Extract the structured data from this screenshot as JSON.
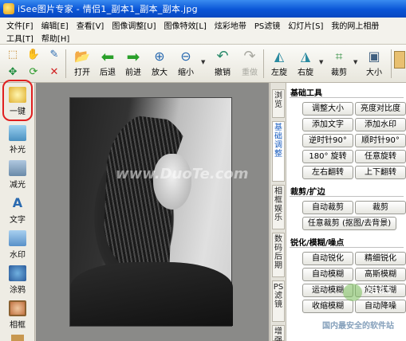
{
  "window": {
    "title": "iSee图片专家 - 情侣1_副本1_副本_副本.jpg"
  },
  "menu": {
    "row1": [
      "文件[F]",
      "编辑[E]",
      "查看[V]",
      "图像调整[U]",
      "图像特效[L]",
      "炫彩地带",
      "PS滤镜",
      "幻灯片[S]",
      "我的网上相册"
    ],
    "row2": [
      "工具[T]",
      "帮助[H]"
    ]
  },
  "toolbar": {
    "tools": [
      {
        "label": "打开",
        "icon": "open-folder-icon"
      },
      {
        "label": "后退",
        "icon": "back-arrow-icon"
      },
      {
        "label": "前进",
        "icon": "forward-arrow-icon"
      },
      {
        "label": "放大",
        "icon": "zoom-in-icon"
      },
      {
        "label": "缩小",
        "icon": "zoom-out-icon"
      },
      {
        "label": "撤销",
        "icon": "undo-icon"
      },
      {
        "label": "重做",
        "icon": "redo-icon",
        "disabled": true
      },
      {
        "label": "左旋",
        "icon": "rotate-left-icon"
      },
      {
        "label": "右旋",
        "icon": "rotate-right-icon"
      },
      {
        "label": "裁剪",
        "icon": "crop-icon"
      },
      {
        "label": "大小",
        "icon": "resize-icon"
      }
    ]
  },
  "sidebar": {
    "items": [
      {
        "label": "一键",
        "icon": "one-click-icon"
      },
      {
        "label": "补光",
        "icon": "fill-light-icon"
      },
      {
        "label": "减光",
        "icon": "reduce-light-icon"
      },
      {
        "label": "文字",
        "icon": "text-icon"
      },
      {
        "label": "水印",
        "icon": "watermark-icon"
      },
      {
        "label": "涂鸦",
        "icon": "doodle-icon"
      },
      {
        "label": "相框",
        "icon": "frame-icon"
      }
    ]
  },
  "vtabs": [
    {
      "label": "浏览",
      "active": false
    },
    {
      "label": "基础调整",
      "active": true
    },
    {
      "label": "相框娱乐",
      "active": false
    },
    {
      "label": "数码后期",
      "active": false
    },
    {
      "label": "PS滤镜",
      "active": false
    },
    {
      "label": "增强",
      "active": false
    }
  ],
  "panel": {
    "basic": {
      "title": "基础工具",
      "buttons": [
        "调整大小",
        "亮度对比度",
        "添加文字",
        "添加水印",
        "逆时针90°",
        "顺时针90°",
        "180° 旋转",
        "任意旋转",
        "左右翻转",
        "上下翻转"
      ]
    },
    "crop": {
      "title": "裁剪/扩边",
      "buttons": [
        "自动裁剪",
        "裁剪",
        "任意裁剪 (抠图/去背景)"
      ]
    },
    "sharpen": {
      "title": "锐化/模糊/噪点",
      "buttons": [
        "自动锐化",
        "精细锐化",
        "自动模糊",
        "高斯模糊",
        "运动模糊",
        "旋转模糊",
        "收缩模糊",
        "自动降噪"
      ]
    }
  },
  "watermarks": {
    "center": "www.DuoTe.com",
    "logo_top": "2345",
    "logo_bottom": "国内最安全的软件站"
  },
  "colors": {
    "accent": "#0a55d6",
    "highlight": "#e02020"
  }
}
